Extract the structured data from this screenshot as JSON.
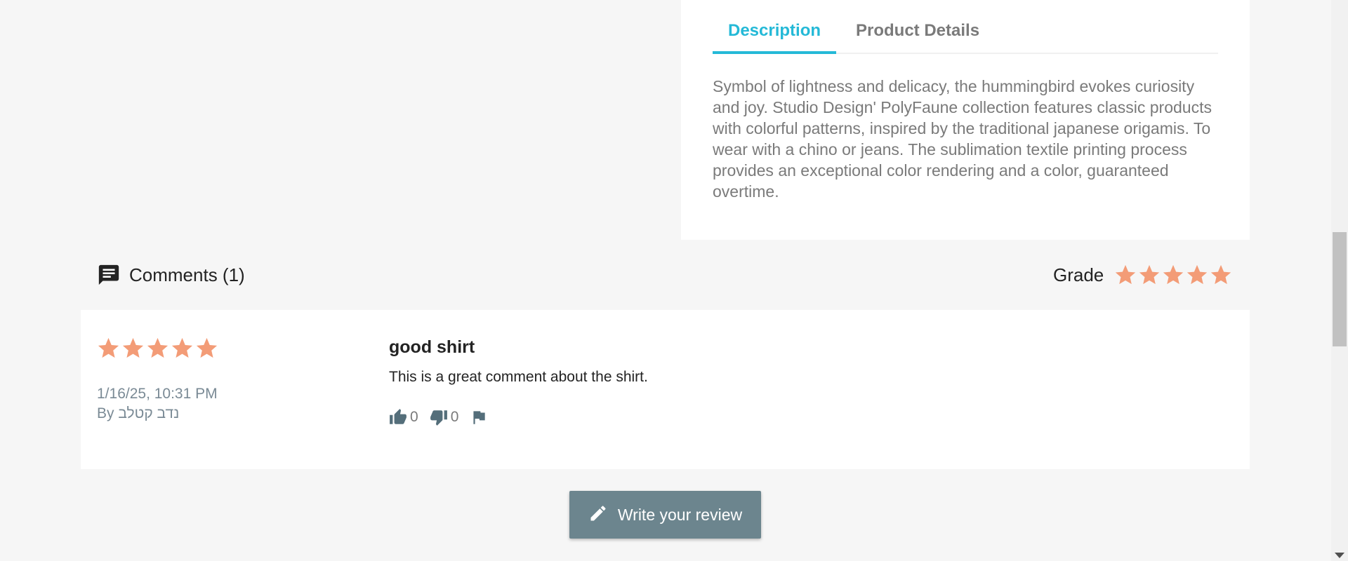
{
  "product": {
    "tabs": [
      {
        "label": "Description",
        "active": true
      },
      {
        "label": "Product Details",
        "active": false
      }
    ],
    "description": "Symbol of lightness and delicacy, the hummingbird evokes curiosity and joy. Studio Design' PolyFaune collection features classic products with colorful patterns, inspired by the traditional japanese origamis. To wear with a chino or jeans. The sublimation textile printing process provides an exceptional color rendering and a color, guaranteed overtime."
  },
  "comments": {
    "title": "Comments (1)",
    "icon": "comment-icon",
    "grade_label": "Grade",
    "grade_stars": 5,
    "items": [
      {
        "stars": 5,
        "date": "1/16/25, 10:31 PM",
        "author": "By נדב קטלב",
        "title": "good shirt",
        "body": "This is a great comment about the shirt.",
        "likes": "0",
        "dislikes": "0"
      }
    ]
  },
  "write_review": {
    "label": "Write your review",
    "icon": "pencil-icon"
  },
  "colors": {
    "accent": "#24b9d7",
    "star": "#f39c77",
    "button": "#6c858e"
  }
}
